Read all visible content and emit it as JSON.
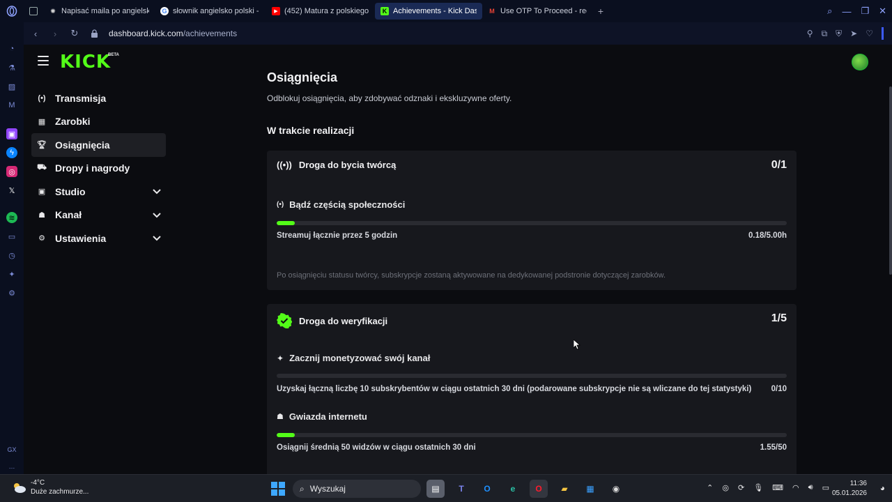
{
  "colors": {
    "kick_green": "#53fc18",
    "bg": "#0b0c10",
    "card": "#17181d",
    "tab_active": "#1a2a55"
  },
  "browser": {
    "tabs": [
      {
        "label": "Napisać maila po angielsk",
        "icon": "openai-icon",
        "active": false
      },
      {
        "label": "słownik angielsko polski -",
        "icon": "google-icon",
        "active": false
      },
      {
        "label": "(452) Matura z polskiego",
        "icon": "youtube-icon",
        "active": false
      },
      {
        "label": "Achievements - Kick Dash",
        "icon": "kick-icon",
        "active": true
      },
      {
        "label": "Use OTP To Proceed - req",
        "icon": "gmail-icon",
        "active": false
      }
    ],
    "url_host": "dashboard.kick.com",
    "url_path": "/achievements"
  },
  "kick": {
    "logo": "KICK",
    "beta": "BETA",
    "nav": [
      {
        "label": "Transmisja",
        "icon": "broadcast-icon",
        "active": false,
        "expandable": false
      },
      {
        "label": "Zarobki",
        "icon": "earnings-icon",
        "active": false,
        "expandable": false
      },
      {
        "label": "Osiągnięcia",
        "icon": "trophy-icon",
        "active": true,
        "expandable": false
      },
      {
        "label": "Dropy i nagrody",
        "icon": "gift-icon",
        "active": false,
        "expandable": false
      },
      {
        "label": "Studio",
        "icon": "studio-icon",
        "active": false,
        "expandable": true
      },
      {
        "label": "Kanał",
        "icon": "channel-icon",
        "active": false,
        "expandable": true
      },
      {
        "label": "Ustawienia",
        "icon": "settings-icon",
        "active": false,
        "expandable": true
      }
    ]
  },
  "main": {
    "title": "Osiągnięcia",
    "subtitle": "Odblokuj osiągnięcia, aby zdobywać odznaki i ekskluzywne oferty.",
    "section": "W trakcie realizacji",
    "cards": [
      {
        "title": "Droga do bycia twórcą",
        "count": "0/1",
        "tasks": [
          {
            "title": "Bądź częścią społeczności",
            "desc": "Streamuj łącznie przez 5 godzin",
            "value": "0.18/5.00h",
            "progress": 0.036
          }
        ],
        "note": "Po osiągnięciu statusu twórcy, subskrypcje zostaną aktywowane na dedykowanej podstronie dotyczącej zarobków."
      },
      {
        "title": "Droga do weryfikacji",
        "count": "1/5",
        "tasks": [
          {
            "title": "Zacznij monetyzować swój kanał",
            "desc": "Uzyskaj łączną liczbę 10 subskrybentów w ciągu ostatnich 30 dni (podarowane subskrypcje nie są wliczane do tej statystyki)",
            "value": "0/10",
            "progress": 0.0
          },
          {
            "title": "Gwiazda internetu",
            "desc": "Osiągnij średnią 50 widzów w ciągu ostatnich 30 dni",
            "value": "1.55/50",
            "progress": 0.031
          }
        ]
      }
    ]
  },
  "taskbar": {
    "temperature": "-4°C",
    "weather": "Duże zachmurze...",
    "search": "Wyszukaj",
    "time": "11:36",
    "date": "05.01.2026",
    "apps": [
      "files-icon",
      "teams-icon",
      "outlook-icon",
      "edge-icon",
      "opera-icon",
      "explorer-icon",
      "store-icon",
      "obs-icon"
    ]
  }
}
